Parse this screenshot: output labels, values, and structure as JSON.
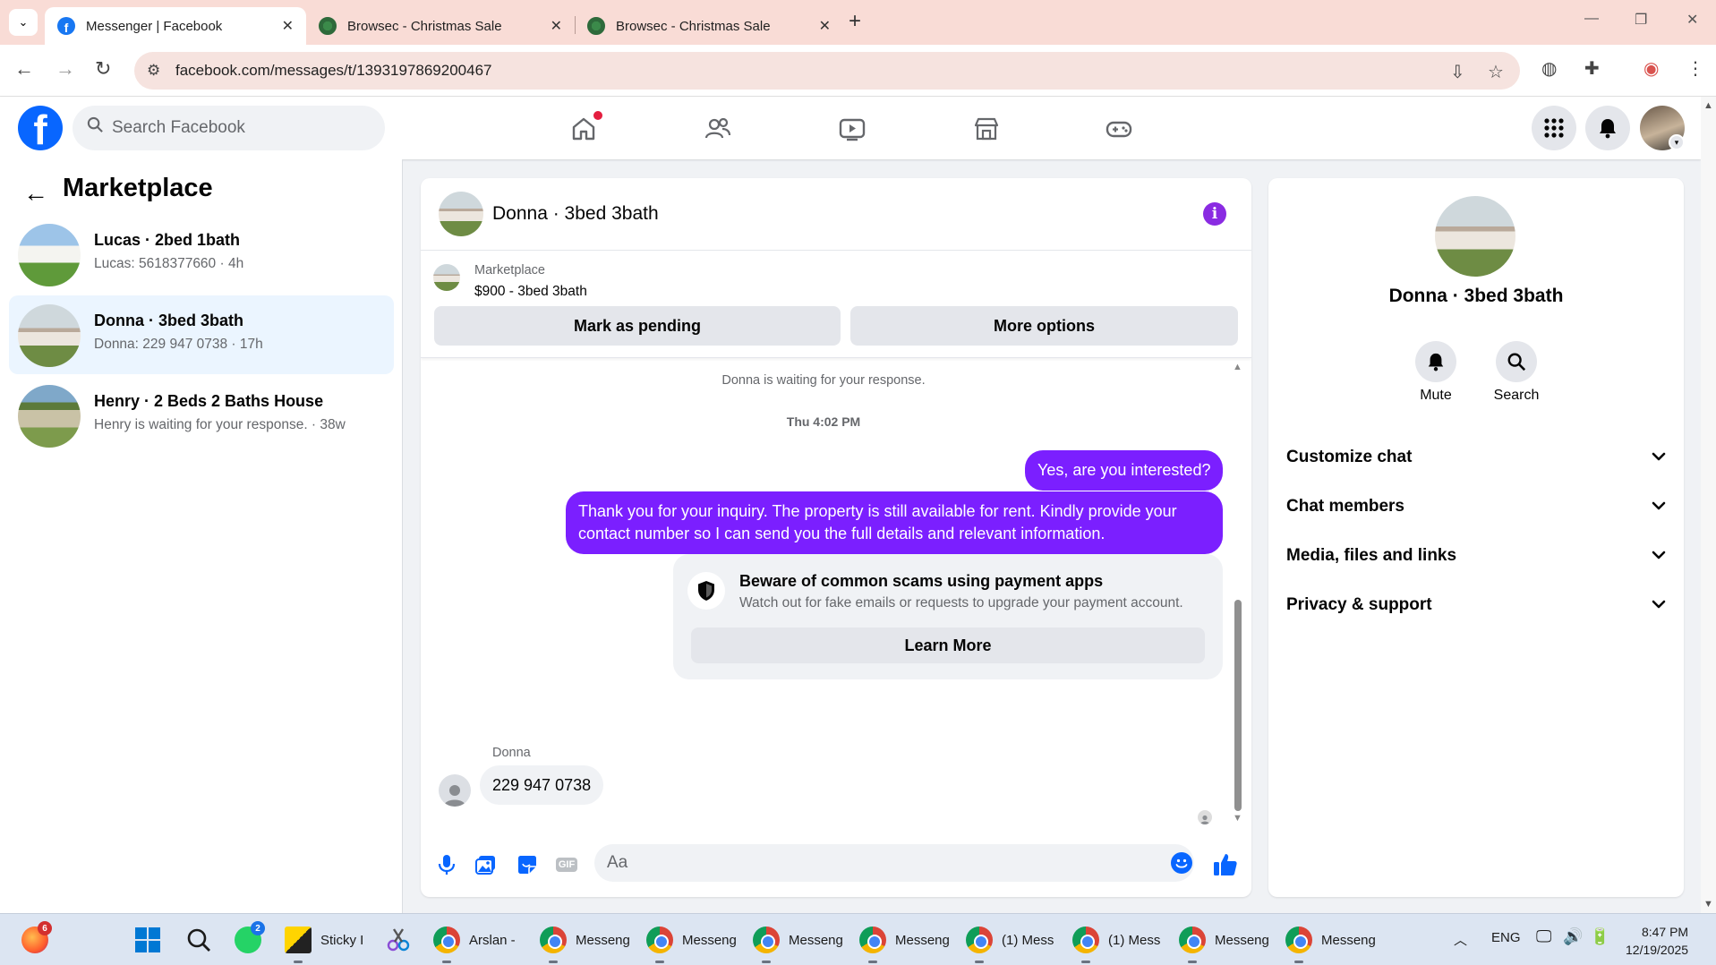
{
  "browser": {
    "tabs": [
      {
        "title": "Messenger | Facebook",
        "active": true
      },
      {
        "title": "Browsec - Christmas Sale",
        "active": false
      },
      {
        "title": "Browsec - Christmas Sale",
        "active": false
      }
    ],
    "url": "facebook.com/messages/t/1393197869200467"
  },
  "fb": {
    "search_placeholder": "Search Facebook",
    "brand_color": "#0866ff"
  },
  "left": {
    "title": "Marketplace",
    "conversations": [
      {
        "name": "Lucas · 2bed 1bath",
        "preview": "Lucas: 5618377660 · 4h",
        "selected": false
      },
      {
        "name": "Donna · 3bed 3bath",
        "preview": "Donna: 229 947 0738 · 17h",
        "selected": true
      },
      {
        "name": "Henry · 2 Beds 2 Baths House",
        "preview": "Henry is waiting for your response. · 38w",
        "selected": false
      }
    ]
  },
  "chat": {
    "title": "Donna · 3bed 3bath",
    "listing": {
      "label": "Marketplace",
      "price_title": "$900 - 3bed 3bath",
      "btn_pending": "Mark as pending",
      "btn_more": "More options"
    },
    "system_waiting": "Donna is waiting for your response.",
    "timestamp": "Thu 4:02 PM",
    "out_msg_1": "Yes, are you interested?",
    "out_msg_2": "Thank you for your inquiry. The property is still available for rent. Kindly provide your contact number so I can send you the full details and relevant information.",
    "warning": {
      "title": "Beware of common scams using payment apps",
      "text": "Watch out for fake emails or requests to upgrade your payment account.",
      "button": "Learn More"
    },
    "in_sender": "Donna",
    "in_msg": "229 947 0738",
    "composer_placeholder": "Aa",
    "accent_color": "#7b1fff"
  },
  "info": {
    "name": "Donna · 3bed 3bath",
    "mute_label": "Mute",
    "search_label": "Search",
    "sections": [
      "Customize chat",
      "Chat members",
      "Media, files and links",
      "Privacy & support"
    ]
  },
  "taskbar": {
    "firefox_badge": "6",
    "whatsapp_badge": "2",
    "items": [
      "Sticky I",
      "Arslan -",
      "Messeng",
      "Messeng",
      "Messeng",
      "Messeng",
      "(1) Mess",
      "(1) Mess",
      "Messeng",
      "Messeng"
    ],
    "lang": "ENG",
    "time": "8:47 PM",
    "date": "12/19/2025"
  }
}
